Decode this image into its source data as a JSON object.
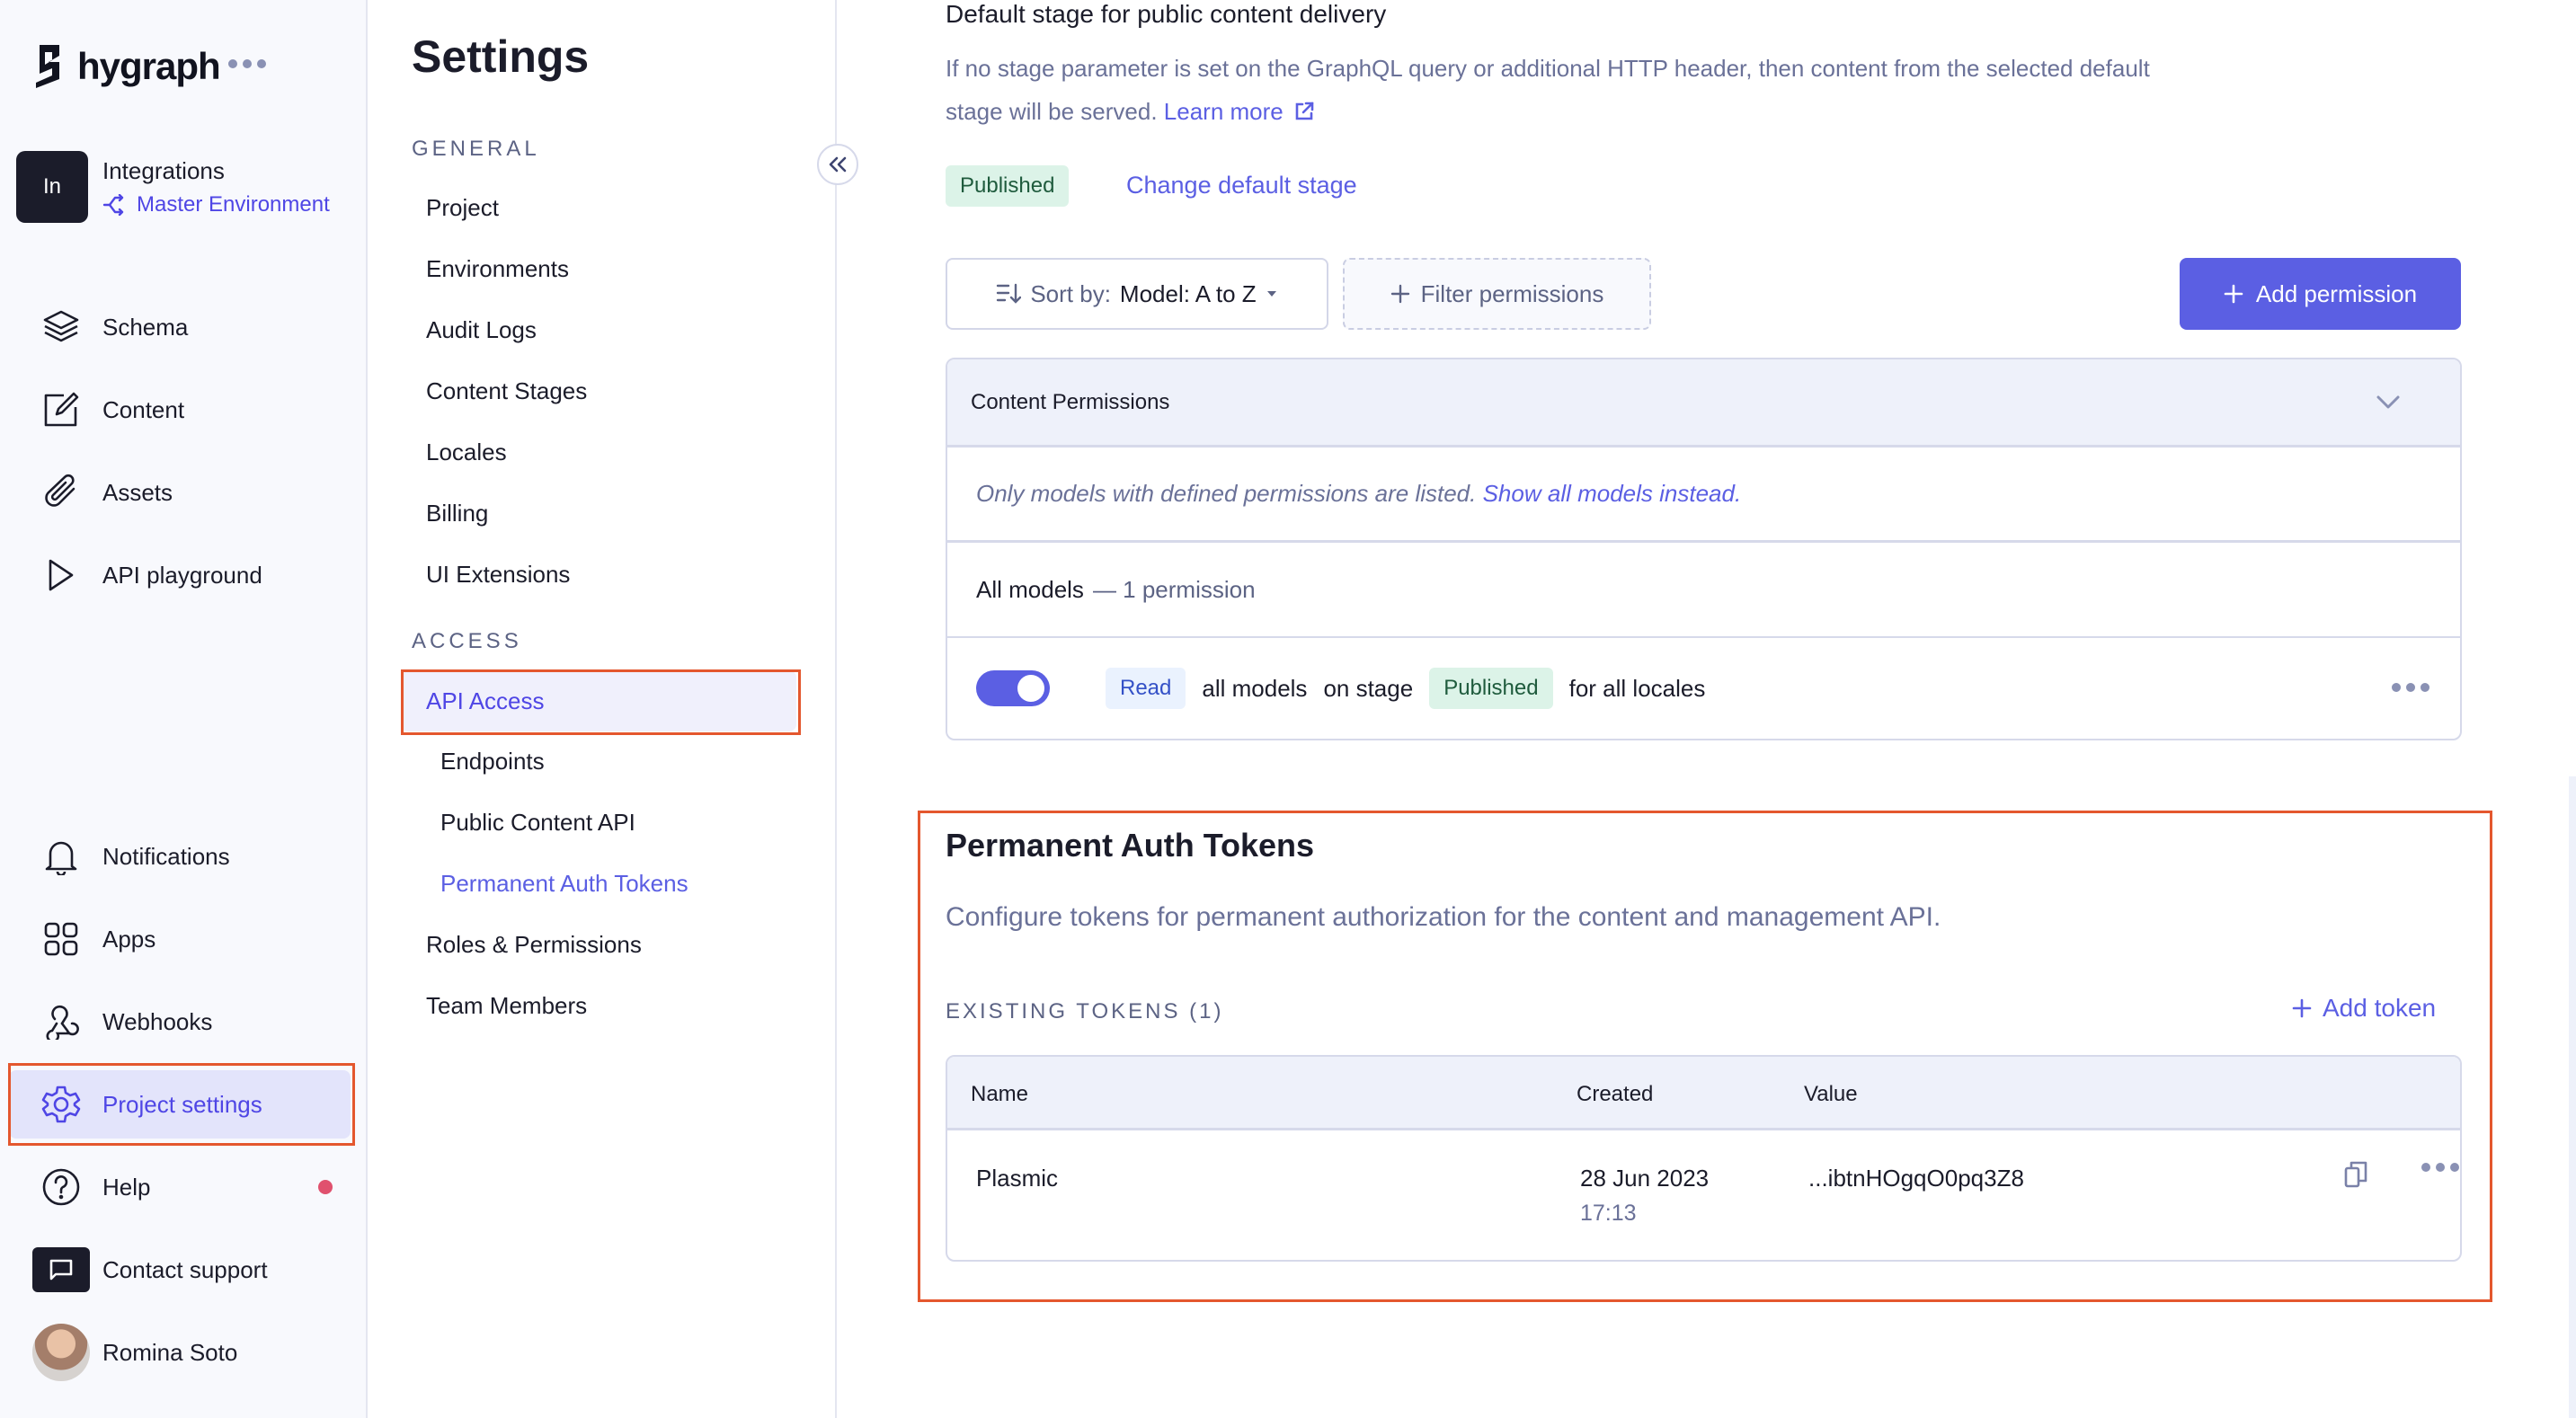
{
  "brand": {
    "name": "hygraph",
    "more_icon": "ellipsis-icon"
  },
  "project": {
    "initials": "In",
    "name": "Integrations",
    "environment": "Master Environment"
  },
  "nav": {
    "top_items": [
      {
        "label": "Schema",
        "icon": "layers-icon"
      },
      {
        "label": "Content",
        "icon": "edit-icon"
      },
      {
        "label": "Assets",
        "icon": "paperclip-icon"
      },
      {
        "label": "API playground",
        "icon": "play-icon"
      }
    ],
    "bottom_items": [
      {
        "label": "Notifications",
        "icon": "bell-icon"
      },
      {
        "label": "Apps",
        "icon": "apps-grid-icon"
      },
      {
        "label": "Webhooks",
        "icon": "webhook-icon"
      },
      {
        "label": "Project settings",
        "icon": "gear-icon",
        "active": true
      },
      {
        "label": "Help",
        "icon": "help-circle-icon",
        "has_notification": true
      },
      {
        "label": "Contact support",
        "icon": "chat-icon"
      },
      {
        "label": "Romina Soto",
        "icon": "user-avatar"
      }
    ]
  },
  "settings_nav": {
    "title": "Settings",
    "groups": [
      {
        "label": "GENERAL",
        "items": [
          "Project",
          "Environments",
          "Audit Logs",
          "Content Stages",
          "Locales",
          "Billing",
          "UI Extensions"
        ]
      },
      {
        "label": "ACCESS",
        "items": [
          "API Access",
          "Endpoints",
          "Public Content API",
          "Permanent Auth Tokens",
          "Roles & Permissions",
          "Team Members"
        ]
      }
    ],
    "active_item": "API Access",
    "collapse_icon": "chevrons-left-icon"
  },
  "default_stage": {
    "heading": "Default stage for public content delivery",
    "description": "If no stage parameter is set on the GraphQL query or additional HTTP header, then content from the selected default stage will be served.",
    "learn_more": "Learn more",
    "current_stage": "Published",
    "change_link": "Change default stage"
  },
  "permissions_toolbar": {
    "sort_prefix": "Sort by:",
    "sort_value": "Model: A to Z",
    "filter_label": "Filter permissions",
    "add_label": "Add permission"
  },
  "content_permissions": {
    "title": "Content Permissions",
    "note": "Only models with defined permissions are listed.",
    "note_link": "Show all models instead.",
    "group_label": "All models",
    "group_count": "— 1 permission",
    "rows": [
      {
        "enabled": true,
        "action": "Read",
        "models": "all models",
        "stage_prefix": "on stage",
        "stage": "Published",
        "locales": "for all locales"
      }
    ]
  },
  "auth_tokens": {
    "title": "Permanent Auth Tokens",
    "description": "Configure tokens for permanent authorization for the content and management API.",
    "existing_label": "EXISTING TOKENS (1)",
    "add_label": "Add token",
    "columns": [
      "Name",
      "Created",
      "Value"
    ],
    "rows": [
      {
        "name": "Plasmic",
        "created_date": "28 Jun 2023",
        "created_time": "17:13",
        "value": "...ibtnHOgqO0pq3Z8"
      }
    ]
  },
  "colors": {
    "accent": "#5b5fe3",
    "highlight": "#e4572e",
    "published_bg": "#dcf3e8",
    "read_bg": "#eaf2fe",
    "notification_dot": "#e0516e"
  }
}
